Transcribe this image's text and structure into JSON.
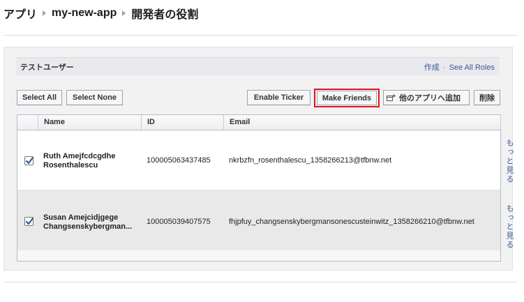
{
  "breadcrumb": {
    "items": [
      "アプリ",
      "my-new-app"
    ],
    "current": "開発者の役割"
  },
  "section": {
    "title": "テストユーザー",
    "create_link": "作成",
    "separator": "·",
    "see_all_link": "See All Roles"
  },
  "toolbar": {
    "select_all": "Select All",
    "select_none": "Select None",
    "enable_ticker": "Enable Ticker",
    "make_friends": "Make Friends",
    "add_to_app": "他のアプリへ追加",
    "delete": "削除"
  },
  "table": {
    "columns": [
      "Name",
      "ID",
      "Email"
    ],
    "rows": [
      {
        "checked": true,
        "name_line1": "Ruth Amejfcdcgdhe",
        "name_line2": "Rosenthalescu",
        "id": "100005063437485",
        "email": "nkrbzfn_rosenthalescu_1358266213@tfbnw.net",
        "more": "もっと見る"
      },
      {
        "checked": true,
        "name_line1": "Susan Amejcidjgege",
        "name_line2": "Changsenskybergman...",
        "id": "100005039407575",
        "email": "fhjpfuy_changsenskybergmansonescusteinwitz_1358266210@tfbnw.net",
        "more": "もっと見る"
      }
    ]
  },
  "colors": {
    "link": "#3b5998",
    "highlight_border": "#e0141c",
    "checkbox_check": "#3b5998"
  }
}
